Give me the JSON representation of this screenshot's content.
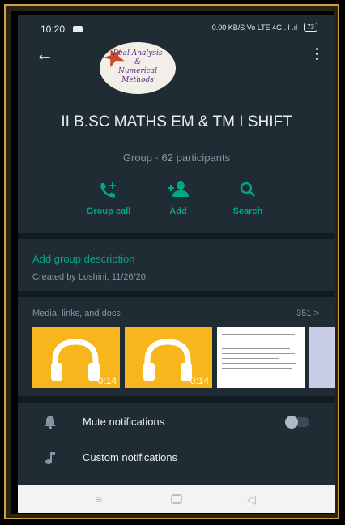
{
  "status_bar": {
    "time": "10:20",
    "right_text": "0.00 KB/S Vo LTE 4G .ıl .ıl",
    "battery": "73"
  },
  "group": {
    "avatar_lines": [
      "Real Analysis",
      "&",
      "Numerical",
      "Methods"
    ],
    "name": "II B.SC MATHS EM & TM I SHIFT",
    "subtitle": "Group · 62 participants"
  },
  "actions": [
    {
      "label": "Group call",
      "icon": "add-call-icon"
    },
    {
      "label": "Add",
      "icon": "add-person-icon"
    },
    {
      "label": "Search",
      "icon": "search-icon"
    }
  ],
  "description": {
    "add_label": "Add group description",
    "created": "Created by Loshini, 11/26/20"
  },
  "media": {
    "title": "Media, links, and docs",
    "count": "351",
    "items": [
      {
        "type": "audio",
        "duration": "0:14",
        "icon": "headphones-icon"
      },
      {
        "type": "audio",
        "duration": "0:14",
        "icon": "headphones-icon"
      },
      {
        "type": "document"
      },
      {
        "type": "image"
      }
    ]
  },
  "settings": [
    {
      "label": "Mute notifications",
      "icon": "bell-icon",
      "toggle": false
    },
    {
      "label": "Custom notifications",
      "icon": "music-note-icon"
    }
  ],
  "navbar": {
    "icons": [
      "menu-icon",
      "home-icon",
      "back-triangle-icon"
    ]
  },
  "colors": {
    "accent": "#00a884",
    "background": "#1f2c34",
    "audio_thumb": "#f7b61c"
  }
}
